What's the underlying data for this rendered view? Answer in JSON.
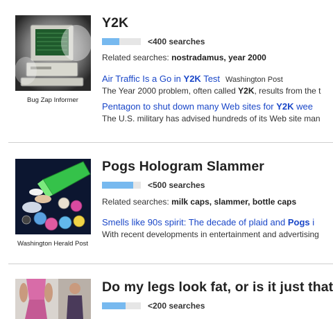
{
  "entries": [
    {
      "title": "Y2K",
      "popularity": 0.45,
      "count": "<400 searches",
      "related_label": "Related searches:",
      "related_terms": "nostradamus, year 2000",
      "caption": "Bug Zap Informer",
      "news": [
        {
          "headline_pre": "Air Traffic Is a Go in ",
          "headline_bold": "Y2K",
          "headline_post": " Test",
          "source": "Washington Post",
          "snippet_pre": "The Year 2000 problem, often called ",
          "snippet_bold": "Y2K",
          "snippet_post": ", results from the t"
        },
        {
          "headline_pre": "Pentagon to shut down many Web sites for ",
          "headline_bold": "Y2K",
          "headline_post": " wee",
          "source": "",
          "snippet_pre": "The U.S. military has advised hundreds of its Web site man",
          "snippet_bold": "",
          "snippet_post": ""
        }
      ]
    },
    {
      "title": "Pogs Hologram Slammer",
      "popularity": 0.8,
      "count": "<500 searches",
      "related_label": "Related searches:",
      "related_terms": "milk caps, slammer, bottle caps",
      "caption": "Washington Herald Post",
      "news": [
        {
          "headline_pre": "Smells like 90s spirit: The decade of plaid and ",
          "headline_bold": "Pogs",
          "headline_post": " i",
          "source": "",
          "snippet_pre": "With recent developments in entertainment and advertising",
          "snippet_bold": "",
          "snippet_post": ""
        }
      ]
    },
    {
      "title": "Do my legs look fat, or is it just that",
      "popularity": 0.6,
      "count": "<200 searches",
      "related_label": "",
      "related_terms": "",
      "caption": "",
      "news": []
    }
  ],
  "colors": {
    "bar_fill": "#77b9ef",
    "bar_track": "#e6e6e6",
    "link": "#1a47c8"
  }
}
